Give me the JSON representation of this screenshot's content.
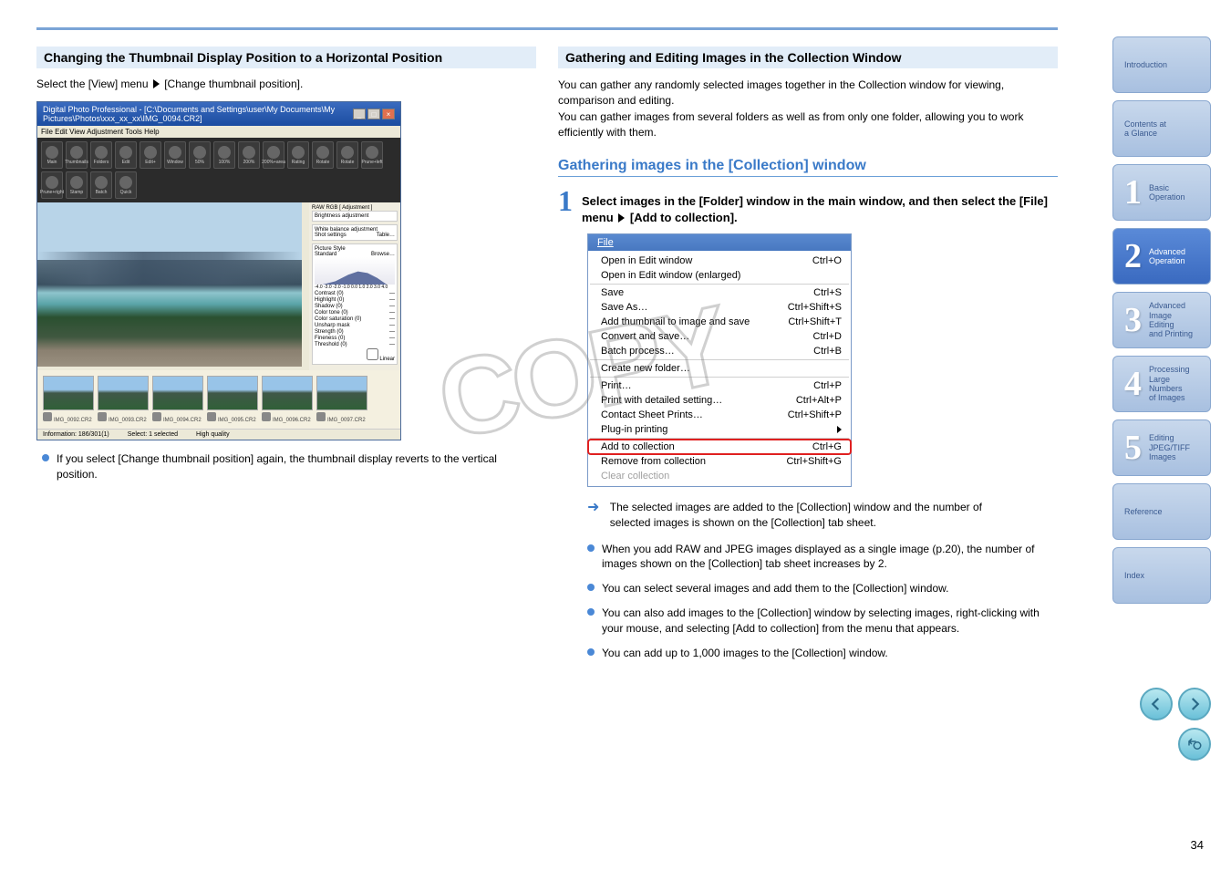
{
  "page_number": "34",
  "watermark": "COPY",
  "left": {
    "section_title": "Changing the Thumbnail Display Position to a Horizontal Position",
    "step": {
      "before": "Select the [View] menu ",
      "after": " [Change thumbnail position]."
    },
    "app": {
      "title": "Digital Photo Professional - [C:\\Documents and Settings\\user\\My Documents\\My Pictures\\Photos\\xxx_xx_xx\\IMG_0094.CR2]",
      "menubar": "File  Edit  View  Adjustment  Tools  Help",
      "tools": [
        "Main",
        "Thumbnails",
        "Folders",
        "Edit",
        "Edit+",
        "Window",
        "50%",
        "100%",
        "200%",
        "200%+area",
        "Rating",
        "Rotate",
        "Rotate",
        "Prune+left",
        "Prune+right",
        "Stamp",
        "Batch",
        "Quick"
      ],
      "side": {
        "tab": "RAW  RGB  [ Adjustment ]",
        "brightness": "Brightness adjustment",
        "wb": "White balance adjustment",
        "shot": "Shot settings",
        "table": "Table…",
        "picstyle": "Picture Style",
        "standard": "Standard",
        "browse": "Browse…",
        "ticks": "-4.0 -3.0 -2.0 -1.0 0.0 1.0 2.0 3.0 4.0",
        "sliders": [
          "Contrast (0)",
          "Highlight (0)",
          "Shadow (0)",
          "Color tone (0)",
          "Color saturation (0)",
          "Unsharp mask",
          "Strength (0)",
          "Fineness (0)",
          "Threshold (0)"
        ],
        "linear": "Linear"
      },
      "thumbs": [
        "IMG_0092.CR2",
        "IMG_0093.CR2",
        "IMG_0094.CR2",
        "IMG_0095.CR2",
        "IMG_0096.CR2",
        "IMG_0097.CR2"
      ],
      "status": {
        "a": "Information: 186/301(1)",
        "b": "Select: 1 selected",
        "c": "High quality"
      }
    },
    "bullet": "If you select [Change thumbnail position] again, the thumbnail display reverts to the vertical position."
  },
  "right": {
    "section_title": "Gathering and Editing Images in the Collection Window",
    "intro": "You can gather any randomly selected images together in the Collection window for viewing, comparison and editing.\nYou can gather images from several folders as well as from only one folder, allowing you to work efficiently with them.",
    "subheading": "Gathering images in the [Collection] window",
    "step1": {
      "before": "Select images in the [Folder] window in the main window, and then select the [File] menu ",
      "after": " [Add to collection]."
    },
    "file_menu": {
      "header": "File",
      "items": [
        {
          "label": "Open in Edit window",
          "sc": "Ctrl+O"
        },
        {
          "label": "Open in Edit window (enlarged)",
          "sc": ""
        },
        {
          "sep": true
        },
        {
          "label": "Save",
          "sc": "Ctrl+S"
        },
        {
          "label": "Save As…",
          "sc": "Ctrl+Shift+S"
        },
        {
          "label": "Add thumbnail to image and save",
          "sc": "Ctrl+Shift+T"
        },
        {
          "label": "Convert and save…",
          "sc": "Ctrl+D"
        },
        {
          "label": "Batch process…",
          "sc": "Ctrl+B"
        },
        {
          "sep": true
        },
        {
          "label": "Create new folder…",
          "sc": ""
        },
        {
          "sep": true
        },
        {
          "label": "Print…",
          "sc": "Ctrl+P"
        },
        {
          "label": "Print with detailed setting…",
          "sc": "Ctrl+Alt+P"
        },
        {
          "label": "Contact Sheet Prints…",
          "sc": "Ctrl+Shift+P"
        },
        {
          "label": "Plug-in printing",
          "sc": "",
          "submenu": true
        },
        {
          "sep": true
        },
        {
          "label": "Add to collection",
          "sc": "Ctrl+G",
          "highlight": true
        },
        {
          "label": "Remove from collection",
          "sc": "Ctrl+Shift+G"
        },
        {
          "label": "Clear collection",
          "sc": "",
          "disabled": true
        }
      ]
    },
    "result": "The selected images are added to the [Collection] window and the number of selected images is shown on the [Collection] tab sheet.",
    "bullets": [
      "When you add RAW and JPEG images displayed as a single image (p.20), the number of images shown on the [Collection] tab sheet increases by 2.",
      "You can select several images and add them to the [Collection] window.",
      "You can also add images to the [Collection] window by selecting images, right-clicking with your mouse, and selecting [Add to collection] from the menu that appears.",
      "You can add up to 1,000 images to the [Collection] window."
    ]
  },
  "sidebar": [
    {
      "num": "",
      "label": "Introduction"
    },
    {
      "num": "",
      "label": "Contents at\na Glance"
    },
    {
      "num": "1",
      "label": "Basic\nOperation"
    },
    {
      "num": "2",
      "label": "Advanced\nOperation",
      "active": true
    },
    {
      "num": "3",
      "label": "Advanced\nImage Editing\nand Printing"
    },
    {
      "num": "4",
      "label": "Processing\nLarge Numbers\nof Images"
    },
    {
      "num": "5",
      "label": "Editing\nJPEG/TIFF\nImages"
    },
    {
      "num": "",
      "label": "Reference"
    },
    {
      "num": "",
      "label": "Index"
    }
  ]
}
